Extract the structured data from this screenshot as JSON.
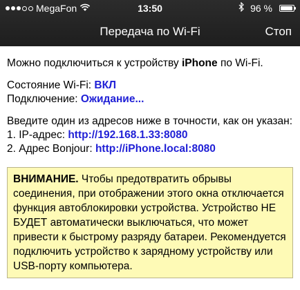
{
  "status_bar": {
    "carrier": "MegaFon",
    "time": "13:50",
    "battery_text": "96 %",
    "battery_level": 0.96
  },
  "nav": {
    "title": "Передача по Wi-Fi",
    "stop_label": "Стоп"
  },
  "content": {
    "intro_prefix": "Можно подключиться к устройству ",
    "intro_device": "iPhone",
    "intro_suffix": " по Wi-Fi.",
    "wifi_state_label": "Состояние Wi-Fi: ",
    "wifi_state_value": "ВКЛ",
    "connection_label": "Подключение: ",
    "connection_value": "Ожидание...",
    "instruction": "Введите один из адресов ниже в точности, как он указан:",
    "ip_label": "1. IP-адрес: ",
    "ip_value": "http://192.168.1.33:8080",
    "bonjour_label": "2. Адрес Bonjour: ",
    "bonjour_value": "http://iPhone.local:8080"
  },
  "warning": {
    "heading": "ВНИМАНИЕ.",
    "text": " Чтобы предотвратить обрывы соединения, при отображении этого окна отключается функция автоблокировки устройства. Устройство НЕ БУДЕТ автоматически выключаться, что может привести к быстрому разряду батареи. Рекомендуется подключить устройство к зарядному устройству или USB-порту компьютера."
  }
}
